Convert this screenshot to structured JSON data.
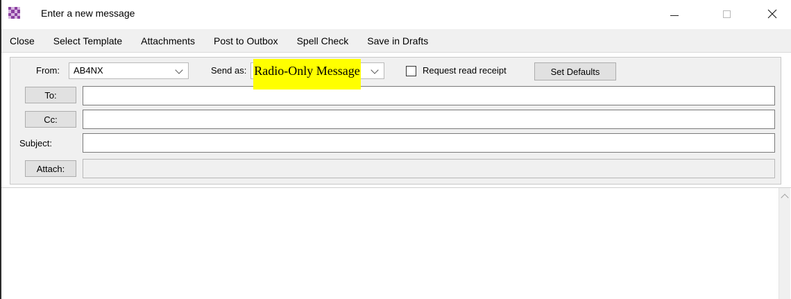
{
  "window": {
    "title": "Enter a new message"
  },
  "menu": {
    "items": [
      "Close",
      "Select Template",
      "Attachments",
      "Post to Outbox",
      "Spell Check",
      "Save in Drafts"
    ]
  },
  "form": {
    "from_label": "From:",
    "from_value": "AB4NX",
    "send_as_label": "Send as:",
    "send_as_value": "Radio-Only Message",
    "request_receipt_label": "Request read receipt",
    "request_receipt_checked": false,
    "set_defaults_label": "Set Defaults",
    "to_button": "To:",
    "to_value": "",
    "cc_button": "Cc:",
    "cc_value": "",
    "subject_label": "Subject:",
    "subject_value": "",
    "attach_button": "Attach:",
    "attach_value": ""
  },
  "body": {
    "text": ""
  },
  "icons": {
    "app": "app-checker-icon",
    "minimize": "minimize-icon",
    "maximize": "maximize-icon",
    "close": "close-icon",
    "dropdown": "chevron-down-icon",
    "scroll_up": "chevron-up-icon"
  },
  "colors": {
    "highlight": "#ffff00",
    "app_icon_primary": "#8a3fa0",
    "app_icon_secondary": "#d7b6e0"
  }
}
